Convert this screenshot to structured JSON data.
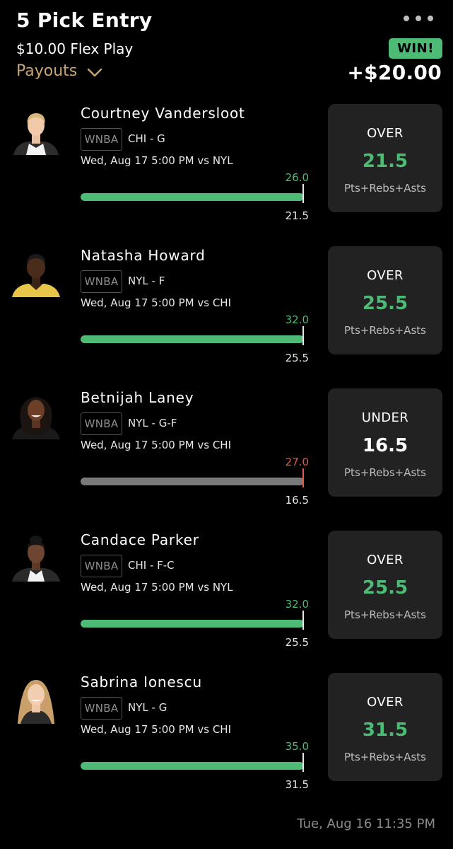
{
  "header": {
    "title": "5 Pick Entry",
    "subtitle": "$10.00 Flex Play",
    "payouts_label": "Payouts",
    "status_badge": "WIN!",
    "winnings": "+$20.00"
  },
  "colors": {
    "hit": "#4dbb76",
    "miss": "#e05a4f",
    "accent": "#c9a477"
  },
  "picks": [
    {
      "player": "Courtney Vandersloot",
      "league": "WNBA",
      "team_pos": "CHI - G",
      "game": "Wed, Aug 17 5:00 PM  vs NYL",
      "actual": "26.0",
      "line": "21.5",
      "direction": "OVER",
      "stat": "Pts+Rebs+Asts",
      "result": "hit",
      "progress": 1.0
    },
    {
      "player": "Natasha Howard",
      "league": "WNBA",
      "team_pos": "NYL - F",
      "game": "Wed, Aug 17 5:00 PM  vs CHI",
      "actual": "32.0",
      "line": "25.5",
      "direction": "OVER",
      "stat": "Pts+Rebs+Asts",
      "result": "hit",
      "progress": 1.0
    },
    {
      "player": "Betnijah Laney",
      "league": "WNBA",
      "team_pos": "NYL - G-F",
      "game": "Wed, Aug 17 5:00 PM  vs CHI",
      "actual": "27.0",
      "line": "16.5",
      "direction": "UNDER",
      "stat": "Pts+Rebs+Asts",
      "result": "miss",
      "progress": 1.0
    },
    {
      "player": "Candace Parker",
      "league": "WNBA",
      "team_pos": "CHI - F-C",
      "game": "Wed, Aug 17 5:00 PM  vs NYL",
      "actual": "32.0",
      "line": "25.5",
      "direction": "OVER",
      "stat": "Pts+Rebs+Asts",
      "result": "hit",
      "progress": 1.0
    },
    {
      "player": "Sabrina Ionescu",
      "league": "WNBA",
      "team_pos": "NYL - G",
      "game": "Wed, Aug 17 5:00 PM  vs CHI",
      "actual": "35.0",
      "line": "31.5",
      "direction": "OVER",
      "stat": "Pts+Rebs+Asts",
      "result": "hit",
      "progress": 1.0
    }
  ],
  "footer": {
    "timestamp": "Tue, Aug 16 11:35 PM"
  }
}
